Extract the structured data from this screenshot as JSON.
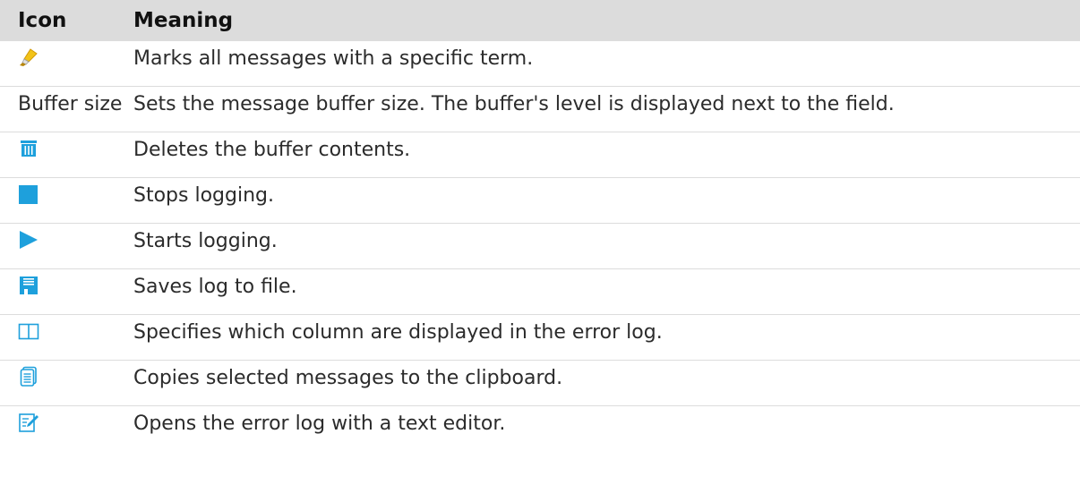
{
  "header": {
    "icon_col": "Icon",
    "meaning_col": "Meaning"
  },
  "rows": [
    {
      "icon": "highlighter-icon",
      "meaning": "Marks all messages with a specific term."
    },
    {
      "icon_text": "Buffer size",
      "meaning": "Sets the message buffer size. The buffer's level is displayed next to the field."
    },
    {
      "icon": "trash-icon",
      "meaning": "Deletes the buffer contents."
    },
    {
      "icon": "stop-icon",
      "meaning": "Stops logging."
    },
    {
      "icon": "play-icon",
      "meaning": "Starts logging."
    },
    {
      "icon": "save-icon",
      "meaning": "Saves log to file."
    },
    {
      "icon": "columns-icon",
      "meaning": "Specifies which column are displayed in the error log."
    },
    {
      "icon": "copy-icon",
      "meaning": "Copies selected messages to the clipboard."
    },
    {
      "icon": "edit-icon",
      "meaning": "Opens the error log with a text editor."
    }
  ],
  "colors": {
    "icon_blue": "#1ea0dc",
    "header_bg": "#dcdcdc",
    "highlighter_yellow": "#f2c318"
  }
}
